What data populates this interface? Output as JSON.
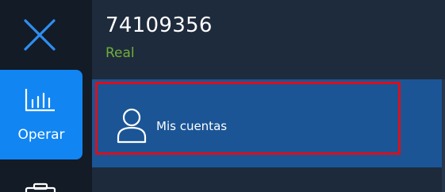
{
  "rail": {
    "close_icon": "close-icon",
    "items": [
      {
        "label": "Operar",
        "icon": "bar-chart-icon",
        "active": true
      },
      {
        "label": "",
        "icon": "briefcase-icon",
        "active": false
      }
    ]
  },
  "account": {
    "number": "74109356",
    "type": "Real"
  },
  "menu": {
    "items": [
      {
        "label": "Mis cuentas",
        "icon": "user-icon",
        "highlighted": true
      }
    ]
  },
  "colors": {
    "rail_bg": "#131b26",
    "panel_bg": "#1d2a3b",
    "accent_blue": "#1185f2",
    "menu_band": "#1b5596",
    "account_type_green": "#6fae3a",
    "highlight_border": "#d8101c",
    "close_icon_blue": "#2f8ef0"
  }
}
